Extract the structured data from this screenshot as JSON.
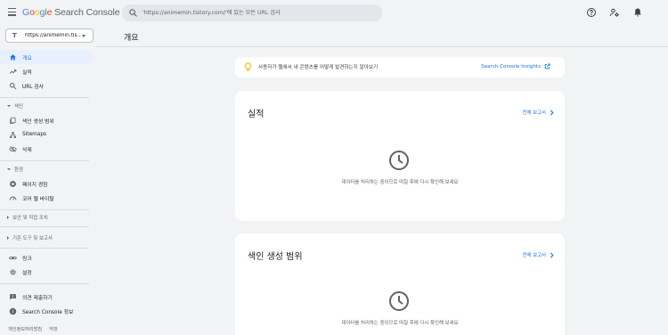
{
  "header": {
    "logo": {
      "g1": "G",
      "g2": "o",
      "g3": "o",
      "g4": "g",
      "g5": "l",
      "g6": "e",
      "product": " Search Console"
    },
    "search": {
      "placeholder": "'https://animemin.tistory.com/'에 있는 모든 URL 검사"
    },
    "icons": [
      "help-icon",
      "account-settings-icon",
      "notifications-icon"
    ]
  },
  "sidebar": {
    "property": "https://animemin.tis...",
    "items": {
      "overview": "개요",
      "performance": "실적",
      "url_inspection": "URL 검사",
      "index_section": "색인",
      "pages": "색인 생성 범위",
      "sitemaps": "Sitemaps",
      "removals": "삭제",
      "experience_section": "환경",
      "page_experience": "페이지 경험",
      "core_web_vitals": "코어 웹 바이탈",
      "security_section": "보안 및 직접 조치",
      "legacy_section": "기존 도구 및 보고서",
      "links": "링크",
      "settings": "설정",
      "feedback": "의견 제출하기",
      "about": "Search Console 정보"
    },
    "footer": {
      "privacy": "개인정보처리방침",
      "terms": "약관"
    }
  },
  "main": {
    "title": "개요",
    "insights": {
      "text": "사용자가 웹에서 내 콘텐츠를 어떻게 발견하는지 알아보기",
      "link": "Search Console Insights"
    },
    "cards": [
      {
        "title": "실적",
        "link": "전체 보고서",
        "message": "데이터를 처리하는 중이므로 며칠 후에 다시 확인해 보세요"
      },
      {
        "title": "색인 생성 범위",
        "link": "전체 보고서",
        "message": "데이터를 처리하는 중이므로 며칠 후에 다시 확인해 보세요"
      }
    ]
  },
  "colors": {
    "accent": "#1a73e8",
    "active_bg": "#e8f0fe",
    "background": "#f1f3f4",
    "bulb": "#fbbc04"
  }
}
